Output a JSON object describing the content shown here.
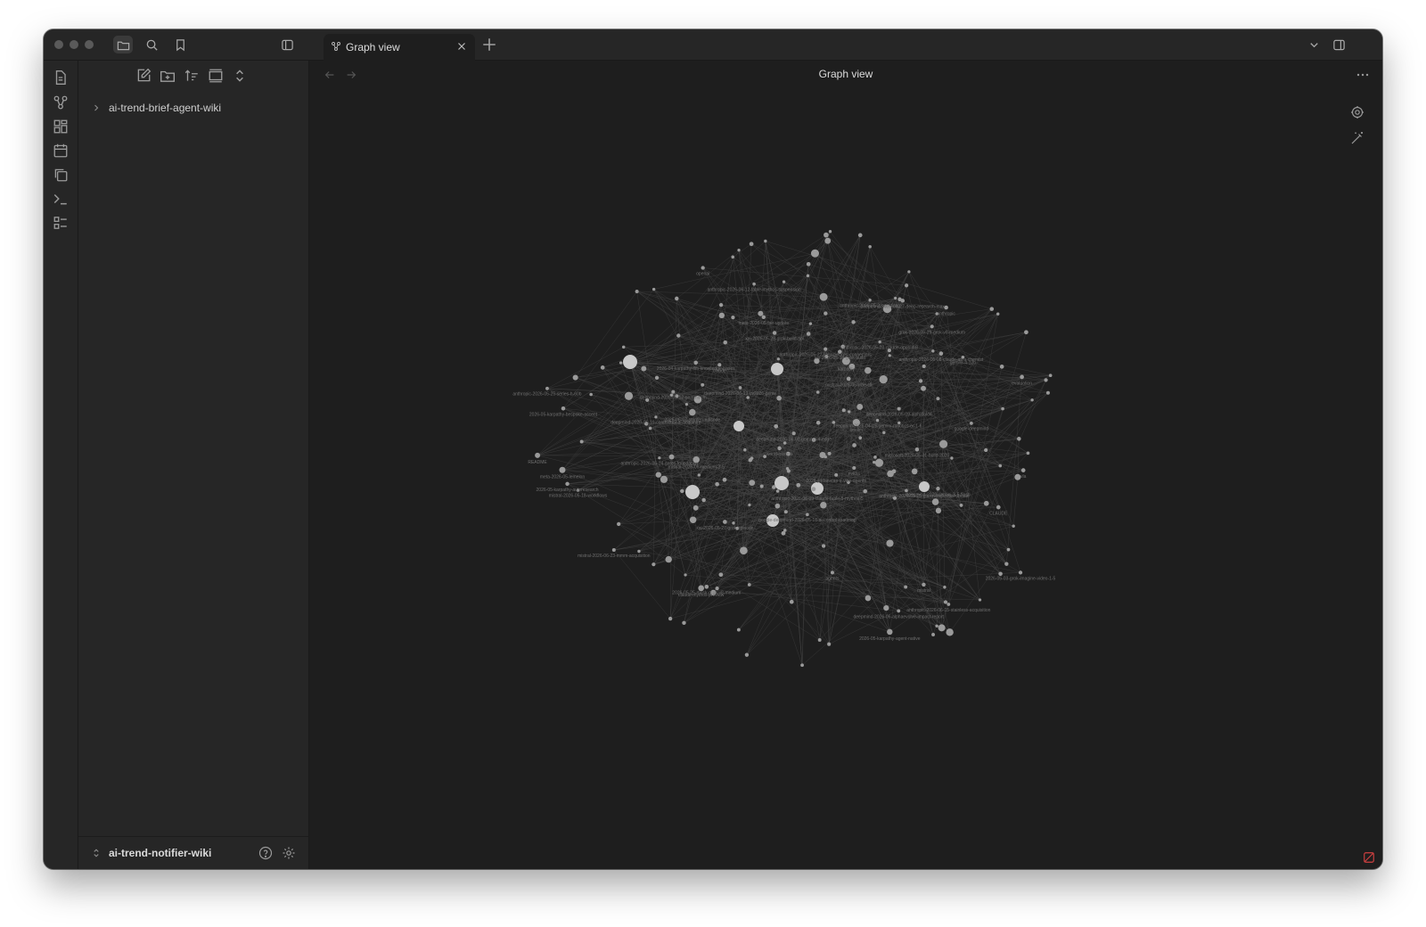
{
  "tab": {
    "title": "Graph view",
    "icon": "graph-icon",
    "close_icon": "close-icon",
    "new_icon": "plus-icon"
  },
  "titlebar_icons": [
    "folder-icon",
    "search-icon",
    "bookmark-icon",
    "sidebar-toggle-icon",
    "chevron-down-icon",
    "right-sidebar-icon"
  ],
  "ribbon_icons": [
    "file-icon",
    "graph-icon",
    "canvas-icon",
    "calendar-icon",
    "copy-icon",
    "terminal-icon",
    "outline-icon"
  ],
  "file_explorer": {
    "toolbar_icons": [
      "new-note-icon",
      "new-folder-icon",
      "sort-icon",
      "collapse-icon",
      "expand-icon"
    ],
    "folders": [
      {
        "label": "ai-trend-brief-agent-wiki",
        "expanded": false
      }
    ]
  },
  "vault": {
    "name": "ai-trend-notifier-wiki",
    "help_icon": "help-icon",
    "settings_icon": "gear-icon"
  },
  "main": {
    "title": "Graph view",
    "nav": {
      "back_icon": "arrow-left-icon",
      "forward_icon": "arrow-right-icon",
      "more_icon": "more-icon"
    },
    "graph_controls": [
      "gear-icon",
      "magic-wand-icon"
    ],
    "status_icon": "sync-error-icon"
  },
  "graph": {
    "labels": [
      "anthropic-2026-06-09-claude-fable-5-mythos-5",
      "anthropic-2026-05-25-glasswing-initial-update",
      "anthropic-2026-06-12-fable-mythos-suspension",
      "claude-mythos-preview",
      "anthropic-2026-05-28-claude-opus-4-8",
      "anthropic-2026-05-23-ipo-filing",
      "anthropic-2026-05-25-series-h-60b",
      "anthropic-2026-05-24-gates-foundation",
      "deepmind-2026-04-27-deep-research-max",
      "deepmind-2026-05-19-contextual-ai-acquihire",
      "deepmind-2026-06-19-cv2026-genie",
      "google-deepmind-2026-05-18-ai-control-roadmap",
      "anthropic-2026-05-22-life-sciences-connectors",
      "anthropic-2026-06-08-claude-as-a-chemist",
      "deepmind-2026-06-02-gemma-4-edge",
      "anthropic-2026-06-15-stainless-acquisition",
      "deepmind-2026-06-alphaevolve-impact-report",
      "google-deepmind",
      "deepmind-2026-05-12-gemma-3n",
      "gemini-4-12b",
      "deepmind-2026-05-09-alphafold4",
      "deepmind-2026-04-15-gemini-robotics-er-1-6",
      "deepmind-2026-gemini-3-5-flash",
      "grok-2026-05-29-grok-v8-medium",
      "2026-05-03-grok-imagine-video-1-5",
      "2026-05-25-musk-grok-v8-medium",
      "2026-05-karpathy-autoresearch",
      "xai-2026-05-28-grok-build-api",
      "xai-2026-05-27-grok-episode",
      "xai-2026-05-14-grok-build",
      "2026-04-karpathy-llm-knowledge-bases",
      "2026-05-karpathy-agent-native",
      "2026-05-karpathy-bespoke-ascent",
      "openai",
      "anthropic",
      "claude",
      "agents",
      "mistral",
      "mistral-2026-06-medium-3-5",
      "mistral-2026-06-23-mmm-acquisition",
      "mistral-2026-05-18-workflows",
      "mistral-2026-06-vibe-cli",
      "2026-06-07-strjnfen-episode",
      "2026-jimfan-cap-x-vibe-agents",
      "meta-2026-05-fair-update",
      "meta-2026-05-lemelon",
      "nvidia",
      "microsoft-2026-05-31-build-2026",
      "README",
      "CLAUDE",
      "karpathy",
      "lim-lim",
      "world-models",
      "vla",
      "evaluation"
    ]
  }
}
